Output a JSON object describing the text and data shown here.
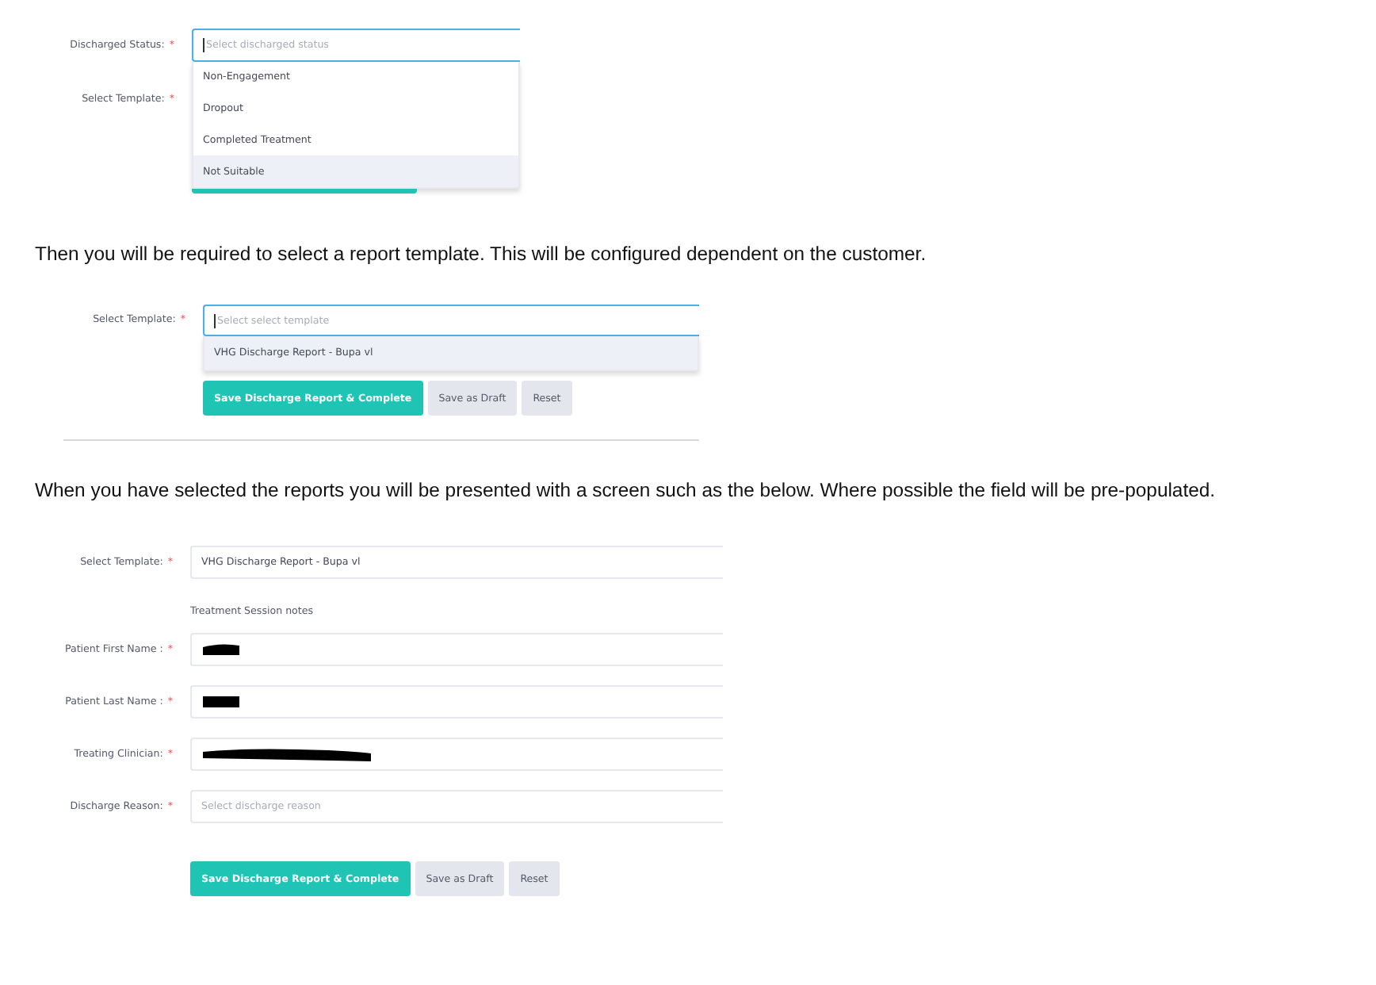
{
  "status_form": {
    "fields": [
      {
        "label": "Discharged Status:",
        "required": "*",
        "placeholder": "Select discharged status",
        "focused": true,
        "options": [
          {
            "label": "Non-Engagement",
            "highlighted": false
          },
          {
            "label": "Dropout",
            "highlighted": false
          },
          {
            "label": "Completed Treatment",
            "highlighted": false
          },
          {
            "label": "Not Suitable",
            "highlighted": true
          }
        ]
      },
      {
        "label": "Select Template:",
        "required": "*"
      }
    ]
  },
  "paragraph_1": "Then you will be required to select a report template. This will be configured dependent on the customer.",
  "template_form": {
    "label": "Select Template:",
    "required": "*",
    "placeholder": "Select select template",
    "focused": true,
    "options": [
      {
        "label": "VHG Discharge Report - Bupa vl",
        "highlighted": true
      }
    ],
    "buttons": [
      {
        "label": "Save Discharge Report & Complete",
        "kind": "primary"
      },
      {
        "label": "Save as Draft",
        "kind": "secondary"
      },
      {
        "label": "Reset",
        "kind": "secondary"
      }
    ]
  },
  "paragraph_2": "When you have selected the reports you will be presented with a screen such as the below. Where possible the field will be pre-populated.",
  "report_form": {
    "template": {
      "label": "Select Template:",
      "required": "*",
      "value": "VHG Discharge Report - Bupa vl"
    },
    "section_note": "Treatment Session notes",
    "fields": [
      {
        "label": "Patient First Name :",
        "required": "*",
        "kind": "redacted"
      },
      {
        "label": "Patient Last Name :",
        "required": "*",
        "kind": "redacted"
      },
      {
        "label": "Treating Clinician:",
        "required": "*",
        "kind": "redacted"
      },
      {
        "label": "Discharge Reason:",
        "required": "*",
        "kind": "select",
        "placeholder": "Select discharge reason"
      }
    ],
    "buttons": [
      {
        "label": "Save Discharge Report & Complete",
        "kind": "primary"
      },
      {
        "label": "Save as Draft",
        "kind": "secondary"
      },
      {
        "label": "Reset",
        "kind": "secondary"
      }
    ]
  }
}
